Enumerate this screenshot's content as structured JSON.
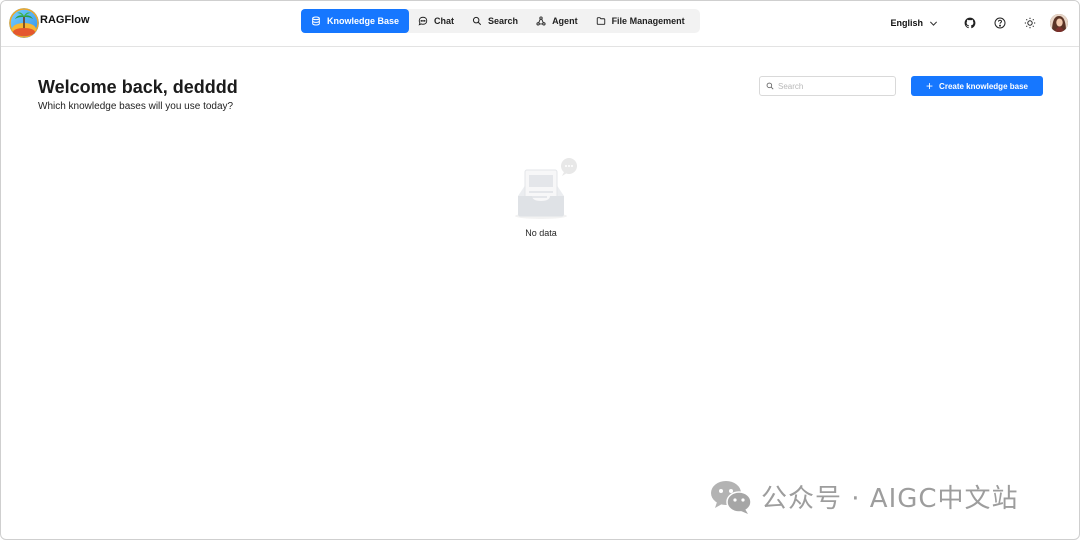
{
  "app": {
    "name": "RAGFlow"
  },
  "nav": {
    "items": [
      {
        "label": "Knowledge Base",
        "icon": "database-icon",
        "active": true
      },
      {
        "label": "Chat",
        "icon": "chat-bubble-icon",
        "active": false
      },
      {
        "label": "Search",
        "icon": "search-icon",
        "active": false
      },
      {
        "label": "Agent",
        "icon": "agent-graph-icon",
        "active": false
      },
      {
        "label": "File Management",
        "icon": "folder-icon",
        "active": false
      }
    ]
  },
  "header_right": {
    "language": "English",
    "icons": [
      "github-icon",
      "help-circle-icon",
      "sun-theme-icon"
    ],
    "avatar": "user-avatar"
  },
  "main": {
    "welcome": "Welcome back, dedddd",
    "subtitle": "Which knowledge bases will you use today?",
    "search_placeholder": "Search",
    "search_value": "",
    "create_button": "Create knowledge base",
    "empty_text": "No data"
  },
  "watermark": {
    "text": "公众号 · AIGC中文站"
  },
  "colors": {
    "accent": "#1677ff",
    "nav_bg": "#f2f2f2",
    "border": "#e3e3e3"
  }
}
